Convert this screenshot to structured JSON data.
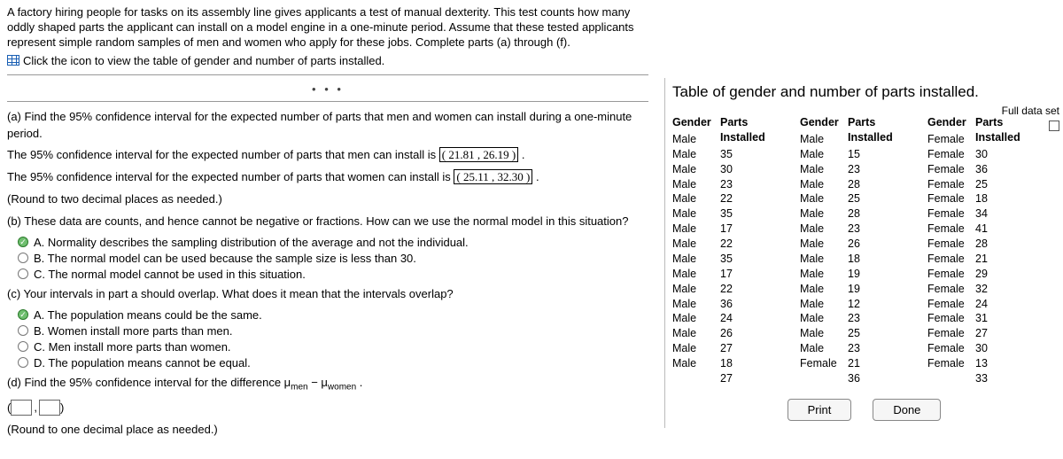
{
  "intro": "A factory hiring people for tasks on its assembly line gives applicants a test of manual dexterity. This test counts how many oddly shaped parts the applicant can install on a model engine in a one-minute period. Assume that these tested applicants represent simple random samples of men and women who apply for these jobs. Complete parts (a) through (f).",
  "icon_link": "Click the icon to view the table of gender and number of parts installed.",
  "dots": "• • •",
  "a": {
    "prompt": "(a)  Find the 95% confidence interval for the expected number of parts that men and women can install during a one-minute period.",
    "men_pre": "The 95% confidence interval for the expected number of parts that men can install is ",
    "men_ci": "( 21.81 , 26.19 )",
    "women_pre": "The 95% confidence interval for the expected number of parts that women can install is ",
    "women_ci": "( 25.11 , 32.30 )",
    "round": "(Round to two decimal places as needed.)"
  },
  "b": {
    "prompt_prefix": "(b)",
    "prompt": "These data are counts, and hence cannot be negative or fractions. How can we use the normal model in this situation?",
    "options": [
      "A.  Normality describes the sampling distribution of the average and not the individual.",
      "B.  The normal model can be used because the sample size is less than 30.",
      "C.  The normal model cannot be used in this situation."
    ]
  },
  "c": {
    "prompt": "(c)  Your intervals in part a should overlap. What does it mean that the intervals overlap?",
    "options": [
      "A.  The population means could be the same.",
      "B.  Women install more parts than men.",
      "C.  Men install more parts than women.",
      "D.  The population means cannot be equal."
    ]
  },
  "d": {
    "prefix": "(d)  Find the 95% confidence interval for the difference μ",
    "sub1": "men",
    "mid": " − μ",
    "sub2": "women",
    "suffix": " .",
    "round": "(Round to one decimal place as needed.)"
  },
  "table": {
    "title": "Table of gender and number of parts installed.",
    "full_data": "Full data set",
    "headers": {
      "gender": "Gender",
      "parts": "Parts Installed"
    },
    "col1_gender": [
      "Male",
      "Male",
      "Male",
      "Male",
      "Male",
      "Male",
      "Male",
      "Male",
      "Male",
      "Male",
      "Male",
      "Male",
      "Male",
      "Male",
      "Male",
      "Male"
    ],
    "col1_parts": [
      35,
      30,
      23,
      22,
      35,
      17,
      22,
      35,
      17,
      22,
      36,
      24,
      26,
      27,
      18,
      27
    ],
    "col2_gender": [
      "Male",
      "Male",
      "Male",
      "Male",
      "Male",
      "Male",
      "Male",
      "Male",
      "Male",
      "Male",
      "Male",
      "Male",
      "Male",
      "Male",
      "Male",
      "Female"
    ],
    "col2_parts": [
      15,
      23,
      28,
      25,
      28,
      23,
      26,
      18,
      19,
      19,
      12,
      23,
      25,
      23,
      21,
      36
    ],
    "col3_gender": [
      "Female",
      "Female",
      "Female",
      "Female",
      "Female",
      "Female",
      "Female",
      "Female",
      "Female",
      "Female",
      "Female",
      "Female",
      "Female",
      "Female",
      "Female",
      "Female"
    ],
    "col3_parts": [
      30,
      36,
      25,
      18,
      34,
      41,
      28,
      21,
      29,
      32,
      24,
      31,
      27,
      30,
      13,
      33
    ],
    "buttons": {
      "print": "Print",
      "done": "Done"
    }
  }
}
